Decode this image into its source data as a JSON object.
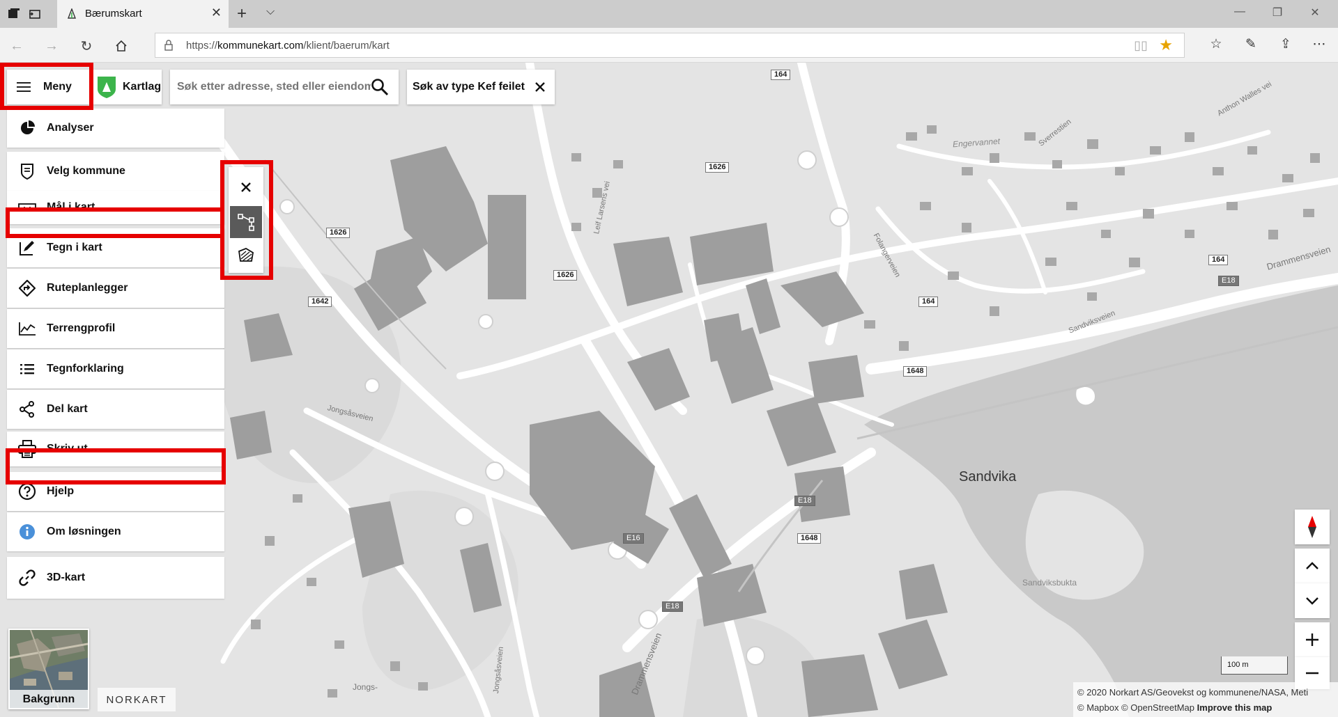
{
  "browser": {
    "tab_title": "Bærumskart",
    "url_prefix": "https://",
    "url_host": "kommunekart.com",
    "url_path": "/klient/baerum/kart",
    "star_color": "#e7a300"
  },
  "toolbar": {
    "menu_label": "Meny",
    "kartlag_label": "Kartlag",
    "search_placeholder": "Søk etter adresse, sted eller eiendom",
    "search_type_label": "Søk av type Kef feilet"
  },
  "menu": {
    "items": [
      {
        "label": "Analyser",
        "icon": "pie-chart-icon"
      },
      {
        "label": "Velg kommune",
        "icon": "municipality-shield-icon"
      },
      {
        "label": "Mål i kart",
        "icon": "ruler-icon"
      },
      {
        "label": "Tegn i kart",
        "icon": "pen-icon"
      },
      {
        "label": "Ruteplanlegger",
        "icon": "route-icon"
      },
      {
        "label": "Terrengprofil",
        "icon": "terrain-profile-icon"
      },
      {
        "label": "Tegnforklaring",
        "icon": "legend-list-icon"
      },
      {
        "label": "Del kart",
        "icon": "share-icon"
      },
      {
        "label": "Skriv ut",
        "icon": "printer-icon"
      },
      {
        "label": "Hjelp",
        "icon": "help-icon"
      },
      {
        "label": "Om løsningen",
        "icon": "info-icon"
      },
      {
        "label": "3D-kart",
        "icon": "link-icon"
      }
    ]
  },
  "map": {
    "place_sandvika": "Sandvika",
    "place_bukta": "Sandviksbukta",
    "place_enger": "Engervannet",
    "roads": {
      "leif": "Leif Larsens vei",
      "jongsas": "Jongsåsveien",
      "jongsas2": "Jongsåsveien",
      "jongs": "Jongs-",
      "drammens": "Drammensveien",
      "drammens2": "Drammensveien",
      "sandviks": "Sandviksveien",
      "folanger": "Folangerveien",
      "sverre": "Sverrestien",
      "anthon": "Anthon Walles vei"
    },
    "shields": {
      "s164a": "164",
      "s1626a": "1626",
      "s1626b": "1626",
      "s1626c": "1626",
      "s1642": "1642",
      "s164b": "164",
      "s164c": "164",
      "s1648a": "1648",
      "s1648b": "1648",
      "sE18a": "E18",
      "sE18b": "E18",
      "sE16": "E16",
      "sE18c": "E18"
    }
  },
  "controls": {
    "scale_label": "100 m",
    "attribution_line1": "© 2020 Norkart AS/Geovekst og kommunene/NASA, Meti",
    "attribution_line2_prefix": "© Mapbox © OpenStreetMap",
    "attribution_improve": "Improve this map",
    "background_label": "Bakgrunn",
    "logo_text": "NORKART"
  },
  "colors": {
    "highlight": "#e60000",
    "kartlag_green": "#3cb44b",
    "info_blue": "#4a90d9"
  }
}
